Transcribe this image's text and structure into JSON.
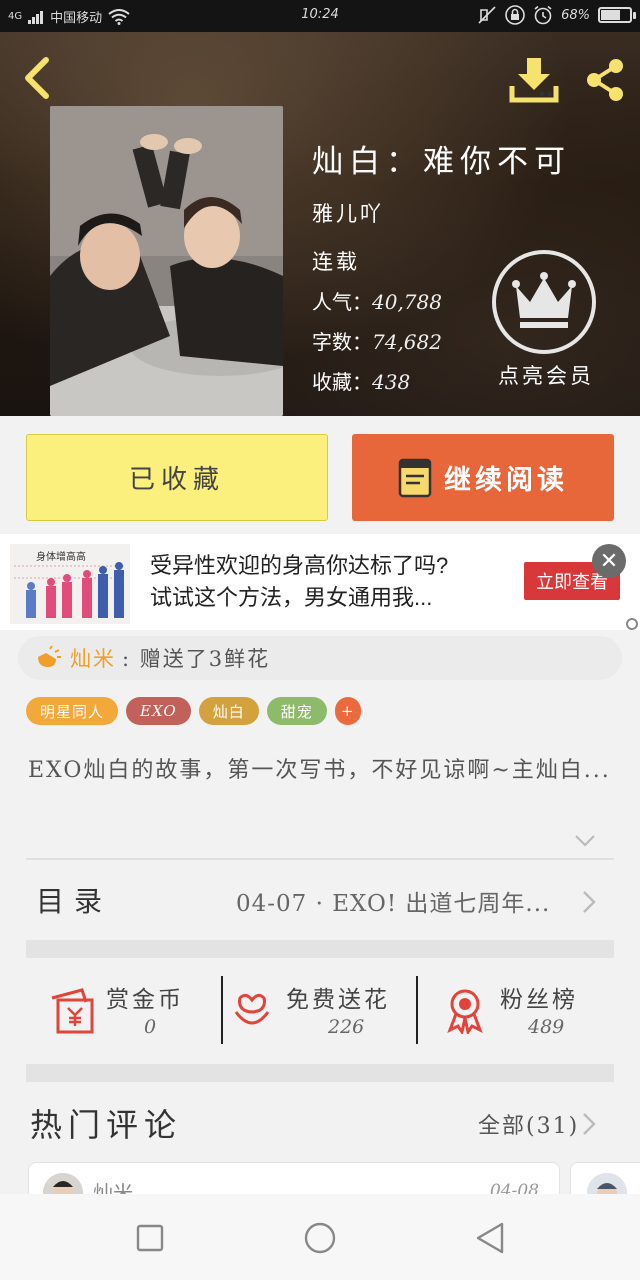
{
  "status_bar": {
    "network": "4G",
    "carrier": "中国移动",
    "time": "10:24",
    "battery": "68%",
    "battery_level": 0.68
  },
  "book": {
    "title": "灿白：难你不可",
    "author": "雅儿吖",
    "status": "连载",
    "stats": [
      {
        "label": "人气：",
        "value": "40,788"
      },
      {
        "label": "字数：",
        "value": "74,682"
      },
      {
        "label": "收藏：",
        "value": "438"
      }
    ],
    "vip_label": "点亮会员"
  },
  "actions": {
    "collected_label": "已收藏",
    "continue_label": "继续阅读"
  },
  "ad": {
    "line1": "受异性欢迎的身高你达标了吗?",
    "line2": "试试这个方法，男女通用我...",
    "cta": "立即查看",
    "image_caption": "身体增高高"
  },
  "gift_notice": {
    "user": "灿米",
    "message": ": 赠送了3鲜花"
  },
  "tags": [
    {
      "label": "明星同人",
      "color": "#f3a83a"
    },
    {
      "label": "EXO",
      "color": "#c2605a"
    },
    {
      "label": "灿白",
      "color": "#d3a23f"
    },
    {
      "label": "甜宠",
      "color": "#8dbb6a"
    },
    {
      "label": "+",
      "color": "#ea6a3d"
    }
  ],
  "description": "EXO灿白的故事，第一次写书，不好见谅啊~主灿白...",
  "catalog": {
    "label": "目录",
    "latest": "04-07 · EXO! 出道七周年..."
  },
  "stats_row": [
    {
      "label": "赏金币",
      "value": "0",
      "icon": "red-envelope-icon"
    },
    {
      "label": "免费送花",
      "value": "226",
      "icon": "flower-icon"
    },
    {
      "label": "粉丝榜",
      "value": "489",
      "icon": "ribbon-medal-icon"
    }
  ],
  "comments": {
    "title": "热门评论",
    "all_label": "全部(31)",
    "first": {
      "user": "灿米",
      "date": "04-08"
    }
  },
  "colors": {
    "accent_orange": "#e8673a",
    "collected_yellow": "#fbef7d",
    "icon_yellow": "#f6e36e",
    "icon_red": "#e0443a"
  }
}
